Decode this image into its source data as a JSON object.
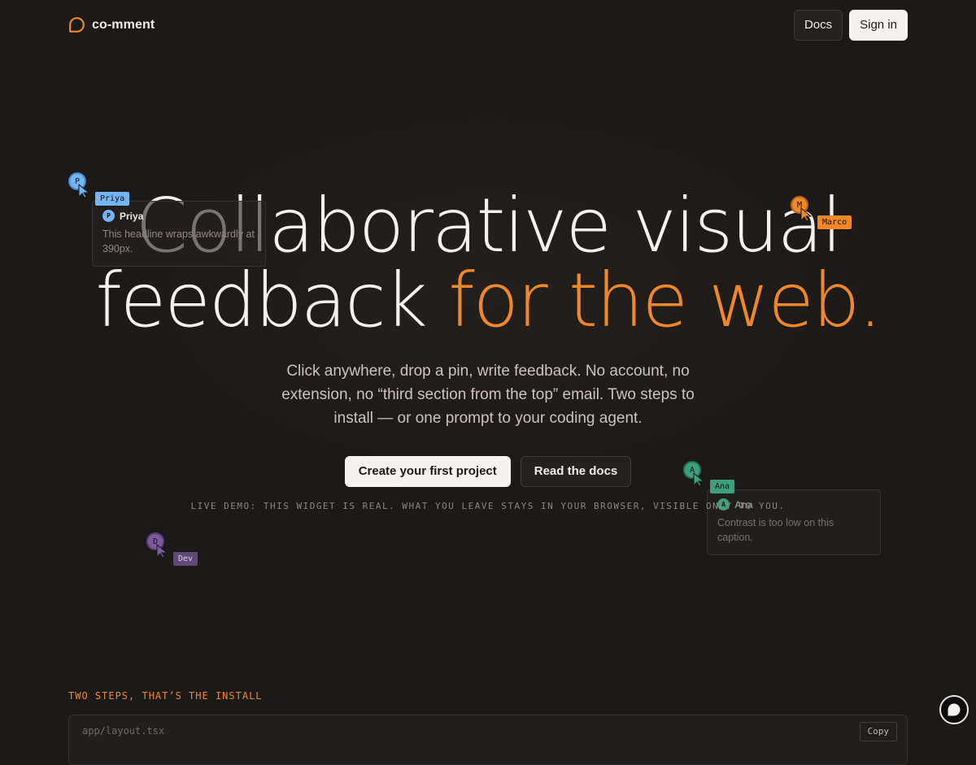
{
  "nav": {
    "brand": "co-mment",
    "docs_label": "Docs",
    "signin_label": "Sign in"
  },
  "hero": {
    "line1": "Collaborative visual",
    "line2_plain": "feedback ",
    "line2_accent": "for the web.",
    "subtitle": "Click anywhere, drop a pin, write feedback. No account, no extension, no “third section from the top” email. Two steps to install — or one prompt to your coding agent.",
    "primary_cta": "Create your first project",
    "secondary_cta": "Read the docs",
    "demo_note": "LIVE DEMO: THIS WIDGET IS REAL. WHAT YOU LEAVE STAYS IN YOUR BROWSER, VISIBLE ONLY TO YOU."
  },
  "cursors": {
    "priya": {
      "initial": "P",
      "name": "Priya",
      "color": "#74b4f2"
    },
    "marco": {
      "initial": "M",
      "name": "Marco",
      "color": "#f0882a"
    },
    "ana": {
      "initial": "A",
      "name": "Ana",
      "color": "#3e9f7e"
    },
    "dev": {
      "initial": "D",
      "name": "Dev",
      "color": "#7b5a9e"
    }
  },
  "comments": {
    "priya": {
      "author": "Priya",
      "text": "This headline wraps awkwardly at 390px."
    },
    "ana": {
      "author": "Ana",
      "text": "Contrast is too low on this caption."
    }
  },
  "install": {
    "section_label": "TWO STEPS, THAT’S THE INSTALL",
    "file_path": "app/layout.tsx",
    "copy_label": "Copy"
  },
  "colors": {
    "accent": "#f0882a",
    "background": "#1c1a19"
  },
  "icons": {
    "logo": "speech-bubble-icon",
    "widget": "comment-bubble-icon"
  }
}
